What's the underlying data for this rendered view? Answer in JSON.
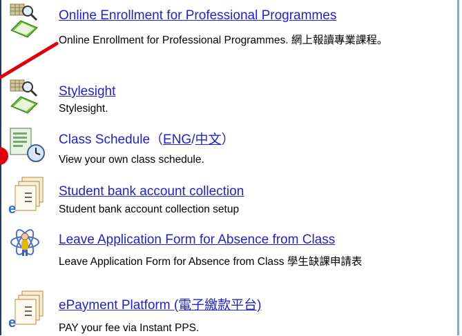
{
  "items": [
    {
      "icon": "book-search-icon",
      "title": "Online Enrollment for Professional Programmes",
      "description": "Online Enrollment for Professional Programmes. 網上報讀專業課程。"
    },
    {
      "icon": "book-search-icon",
      "title": "Stylesight",
      "description": "Stylesight."
    },
    {
      "icon": "document-clock-icon",
      "title_prefix": "Class Schedule（",
      "link_eng": "ENG",
      "separator": "/",
      "link_chi": "中文",
      "title_suffix": "）",
      "description": "View your own class schedule."
    },
    {
      "icon": "e-documents-icon",
      "title": "Student bank account collection",
      "description": "Student bank account collection setup"
    },
    {
      "icon": "atom-person-icon",
      "title": "Leave Application Form for Absence from Class",
      "description": "Leave Application Form for Absence from Class 學生缺課申請表"
    },
    {
      "icon": "e-documents-icon",
      "title": "ePayment Platform (電子繳款平台)",
      "description": "PAY your fee via Instant PPS."
    }
  ],
  "colors": {
    "link": "#1f1fd9",
    "annotation": "#e0000b",
    "frame": "#1f3b6b"
  }
}
